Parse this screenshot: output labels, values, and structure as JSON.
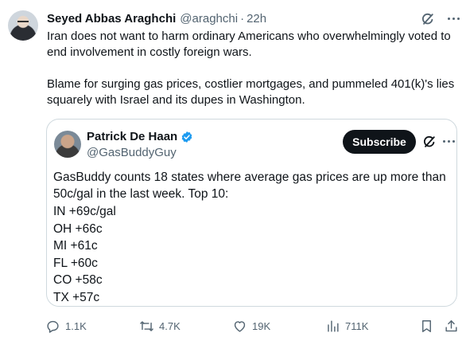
{
  "tweet": {
    "author_name": "Seyed Abbas Araghchi",
    "author_handle": "@araghchi",
    "separator": "·",
    "timestamp": "22h",
    "paragraphs": [
      "Iran does not want to harm ordinary Americans who overwhelmingly voted to end involvement in costly foreign wars.",
      "Blame for surging gas prices, costlier mortgages, and pummeled 401(k)'s lies squarely with Israel and its dupes in Washington."
    ]
  },
  "quoted": {
    "author_name": "Patrick De Haan",
    "author_handle": "@GasBuddyGuy",
    "subscribe_label": "Subscribe",
    "intro": "GasBuddy counts 18 states where average gas prices are up more than 50c/gal in the last week. Top 10:",
    "lines": [
      "IN +69c/gal",
      "OH +66c",
      "MI +61c",
      "FL +60c",
      "CO +58c",
      "TX +57c"
    ]
  },
  "actions": {
    "replies": "1.1K",
    "reposts": "4.7K",
    "likes": "19K",
    "views": "711K"
  },
  "colors": {
    "text": "#0f1419",
    "secondary": "#536471",
    "border": "#cfd9de",
    "verified": "#1d9bf0"
  },
  "icons": [
    "grok-icon",
    "more-icon",
    "verified-badge-icon",
    "reply-icon",
    "repost-icon",
    "like-icon",
    "views-icon",
    "bookmark-icon",
    "share-icon"
  ]
}
